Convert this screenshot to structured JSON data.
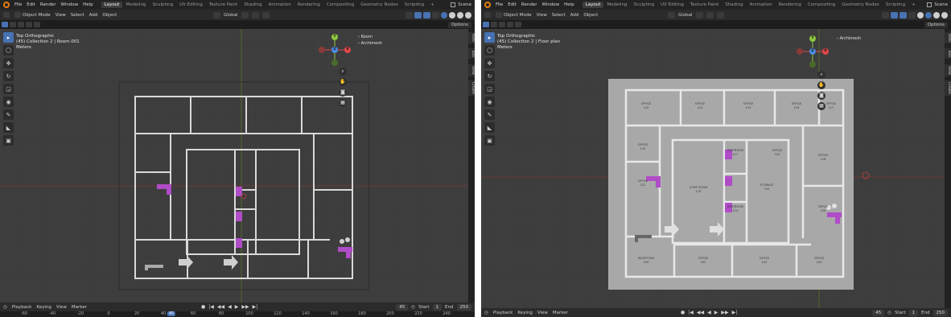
{
  "menu": [
    "File",
    "Edit",
    "Render",
    "Window",
    "Help"
  ],
  "workspaces_left": [
    "Layout",
    "Modeling",
    "Sculpting",
    "UV Editing",
    "Texture Paint",
    "Shading",
    "Animation",
    "Rendering",
    "Compositing",
    "Geometry Nodes",
    "Scripting",
    "+"
  ],
  "workspaces_right": [
    "Layout",
    "Modeling",
    "Sculpting",
    "UV Editing",
    "Texture Paint",
    "Shading",
    "Animation",
    "Rendering",
    "Compositing",
    "Geometry Nodes",
    "Scripting",
    "+"
  ],
  "active_workspace": "Layout",
  "scene_label": "Scene",
  "header": {
    "mode": "Object Mode",
    "view": "View",
    "select": "Select",
    "add": "Add",
    "object": "Object",
    "transform": "Global",
    "options": "Options"
  },
  "left_view": {
    "view_name": "Top Orthographic",
    "collection": "(45) Collection 2 | Room.001",
    "units": "Meters",
    "outliner": [
      "Room",
      "Archimesh"
    ]
  },
  "right_view": {
    "view_name": "Top Orthographic",
    "collection": "(45) Collection 2 | Floor plan",
    "units": "Meters",
    "outliner": [
      "Archimesh"
    ]
  },
  "side_tabs": [
    "Item",
    "Tool",
    "View",
    "Create"
  ],
  "gizmo": {
    "x": "X",
    "y": "Y",
    "z": "Z"
  },
  "nav_icons": [
    "zoom-icon",
    "hand-icon",
    "camera-icon",
    "grid-icon"
  ],
  "timeline": {
    "playback": "Playback",
    "keying": "Keying",
    "view": "View",
    "marker": "Marker",
    "current_frame": "45",
    "start_label": "Start",
    "start": "1",
    "end_label": "End",
    "end": "250"
  },
  "ruler_ticks": [
    "-60",
    "-40",
    "-20",
    "0",
    "20",
    "40",
    "45",
    "60",
    "80",
    "100",
    "120",
    "140",
    "160",
    "180",
    "200",
    "220",
    "240"
  ],
  "room_labels": [
    {
      "name": "OFFICE",
      "num": "110"
    },
    {
      "name": "OFFICE",
      "num": "112"
    },
    {
      "name": "OFFICE",
      "num": "113"
    },
    {
      "name": "OFFICE",
      "num": "116"
    },
    {
      "name": "OFFICE",
      "num": "117"
    },
    {
      "name": "OFFICE",
      "num": "118"
    },
    {
      "name": "OFFICE",
      "num": "119"
    },
    {
      "name": "CONF. ROOM",
      "num": "115"
    },
    {
      "name": "RESTROOM",
      "num": "111"
    },
    {
      "name": "RESTROOM",
      "num": "114"
    },
    {
      "name": "STORAGE",
      "num": "110"
    },
    {
      "name": "OFFICE",
      "num": "120"
    },
    {
      "name": "OFFICE",
      "num": "121"
    },
    {
      "name": "RECEPTION",
      "num": "100"
    },
    {
      "name": "OFFICE",
      "num": "102"
    },
    {
      "name": "OFFICE",
      "num": "103"
    },
    {
      "name": "OFFICE",
      "num": "104"
    },
    {
      "name": "OFFICE",
      "num": "105"
    }
  ],
  "colors": {
    "accent": "#4772b3",
    "magenta": "#b04cc8",
    "viewport": "#3d3d3d"
  }
}
